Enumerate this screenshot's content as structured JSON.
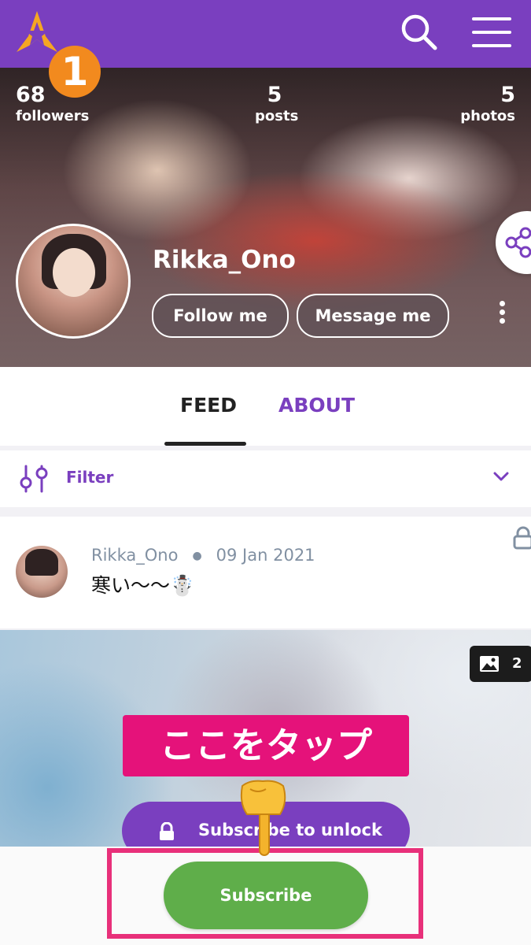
{
  "header": {
    "logo_icon": "star-a-logo-icon",
    "step_badge": "1",
    "search_icon": "search-icon",
    "menu_icon": "hamburger-menu-icon"
  },
  "profile": {
    "stats": [
      {
        "value": "68",
        "label": "followers"
      },
      {
        "value": "5",
        "label": "posts"
      },
      {
        "value": "5",
        "label": "photos"
      }
    ],
    "username": "Rikka_Ono",
    "follow_label": "Follow me",
    "message_label": "Message me",
    "share_icon": "share-icon",
    "more_icon": "more-vertical-icon"
  },
  "tabs": [
    {
      "label": "FEED"
    },
    {
      "label": "ABOUT"
    }
  ],
  "filter": {
    "label": "Filter",
    "icon": "filter-sliders-icon",
    "chevron": "chevron-down-icon"
  },
  "post": {
    "author": "Rikka_Ono",
    "date": "09 Jan 2021",
    "text": "寒い〜〜☃️",
    "lock_icon": "lock-icon",
    "image_count": "2",
    "tap_here_label": "ここをタップ",
    "unlock_label": "Subscribe to unlock"
  },
  "bottom": {
    "subscribe_label": "Subscribe",
    "pointer_icon": "pointing-down-hand-icon"
  },
  "colors": {
    "brand_purple": "#7a3fbf",
    "accent_orange": "#f28a1e",
    "highlight_pink": "#e8307a",
    "subscribe_green": "#5fae4a"
  }
}
